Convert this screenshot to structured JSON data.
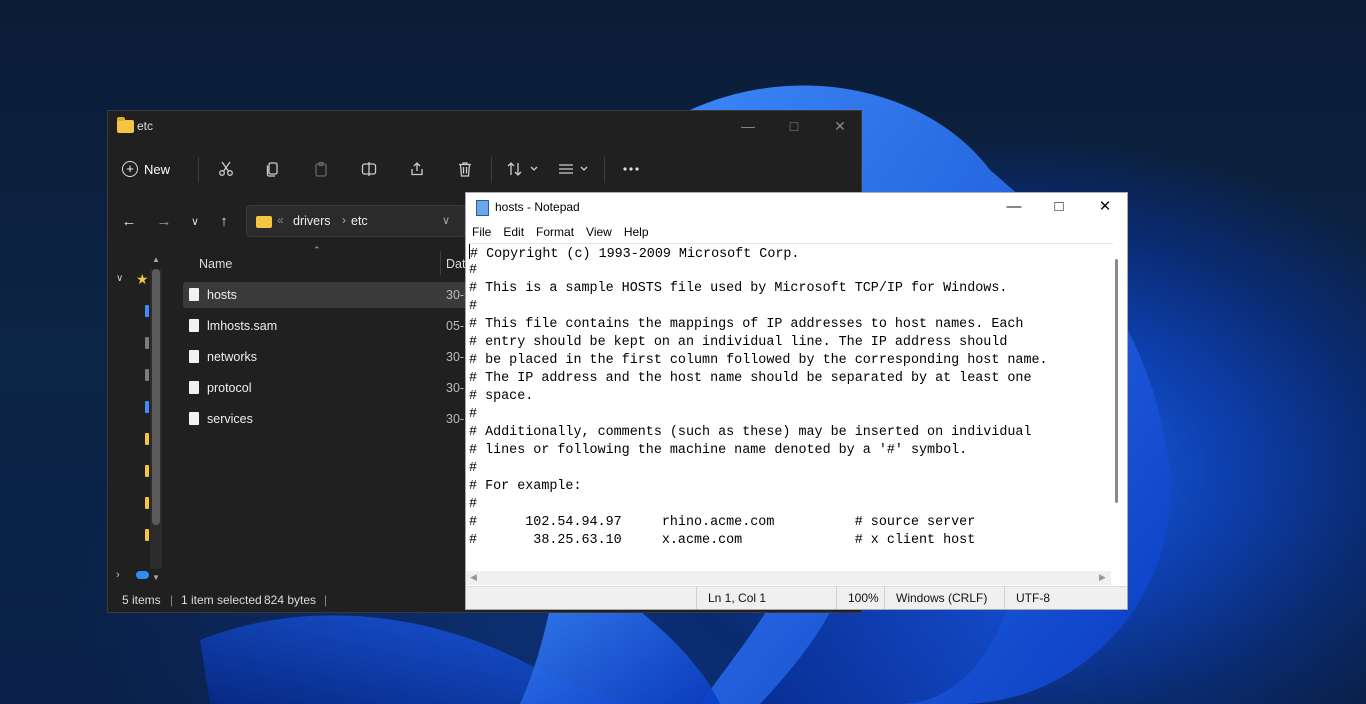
{
  "explorer": {
    "title": "etc",
    "toolbar": {
      "new_label": "New"
    },
    "address": {
      "crumbs": [
        "drivers",
        "etc"
      ]
    },
    "columns": {
      "name": "Name",
      "date": "Dat"
    },
    "files": [
      {
        "name": "hosts",
        "date": "30-",
        "selected": true
      },
      {
        "name": "lmhosts.sam",
        "date": "05-"
      },
      {
        "name": "networks",
        "date": "30-"
      },
      {
        "name": "protocol",
        "date": "30-"
      },
      {
        "name": "services",
        "date": "30-"
      }
    ],
    "status": {
      "items": "5 items",
      "selected": "1 item selected",
      "size": "824 bytes"
    }
  },
  "notepad": {
    "title": "hosts - Notepad",
    "menu": [
      "File",
      "Edit",
      "Format",
      "View",
      "Help"
    ],
    "lines": [
      "# Copyright (c) 1993-2009 Microsoft Corp.",
      "#",
      "# This is a sample HOSTS file used by Microsoft TCP/IP for Windows.",
      "#",
      "# This file contains the mappings of IP addresses to host names. Each",
      "# entry should be kept on an individual line. The IP address should",
      "# be placed in the first column followed by the corresponding host name.",
      "# The IP address and the host name should be separated by at least one",
      "# space.",
      "#",
      "# Additionally, comments (such as these) may be inserted on individual",
      "# lines or following the machine name denoted by a '#' symbol.",
      "#",
      "# For example:",
      "#",
      "#      102.54.94.97     rhino.acme.com          # source server",
      "#       38.25.63.10     x.acme.com              # x client host"
    ],
    "status": {
      "position": "Ln 1, Col 1",
      "zoom": "100%",
      "eol": "Windows (CRLF)",
      "encoding": "UTF-8"
    }
  }
}
